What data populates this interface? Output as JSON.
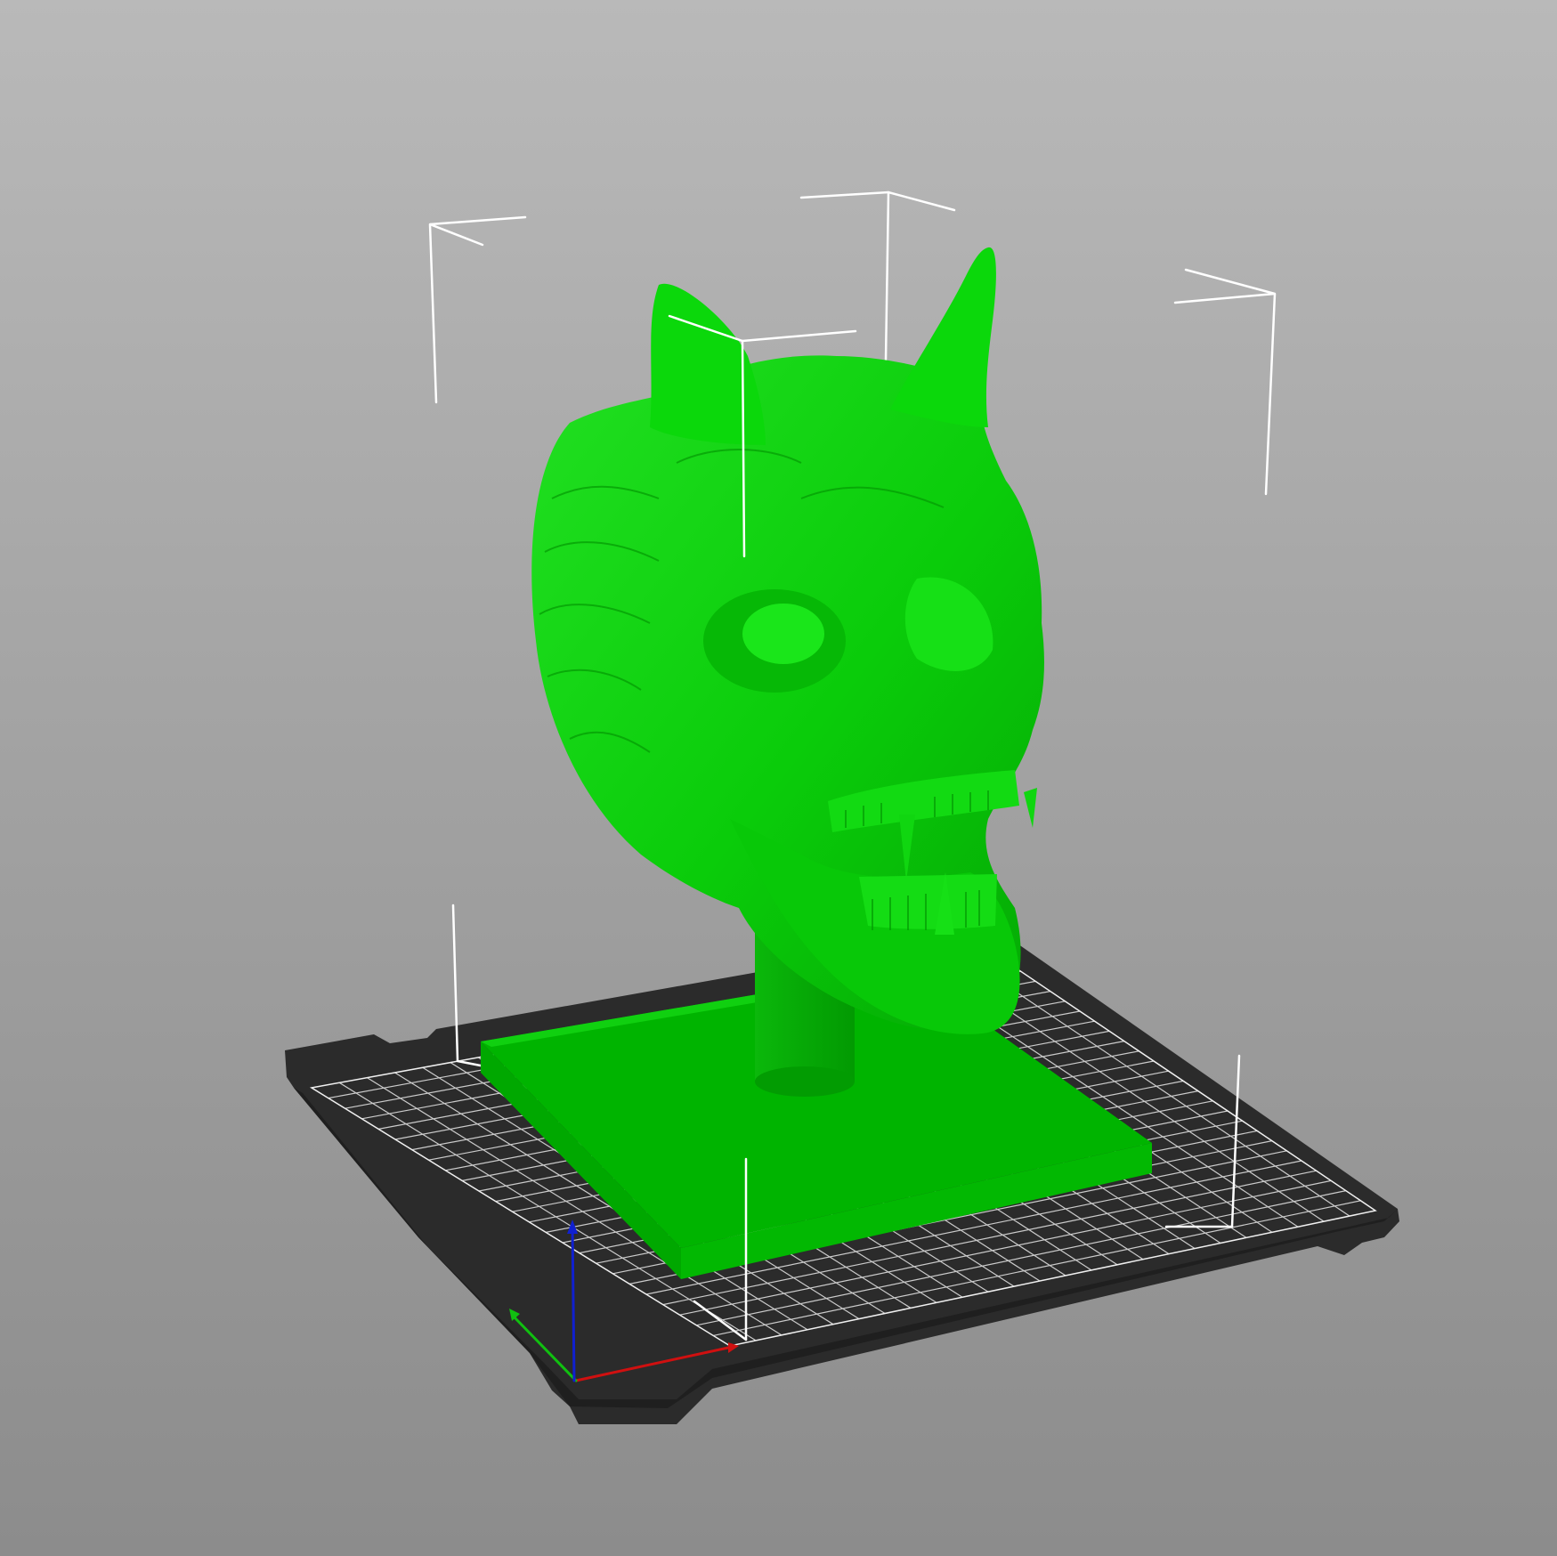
{
  "viewport": {
    "background_top": "#b9b9b9",
    "background_bottom": "#8c8c8c"
  },
  "bed": {
    "plate_color": "#2b2b2b",
    "grid_color": "#ffffff"
  },
  "model": {
    "description_icon": "demon-skull-model",
    "color_light": "#0ee00e",
    "color_mid": "#00c400",
    "color_dark": "#00a000"
  },
  "selection_box": {
    "color": "#ffffff"
  },
  "axes": {
    "x_color": "#d01010",
    "y_color": "#10c010",
    "z_color": "#1020d0"
  }
}
